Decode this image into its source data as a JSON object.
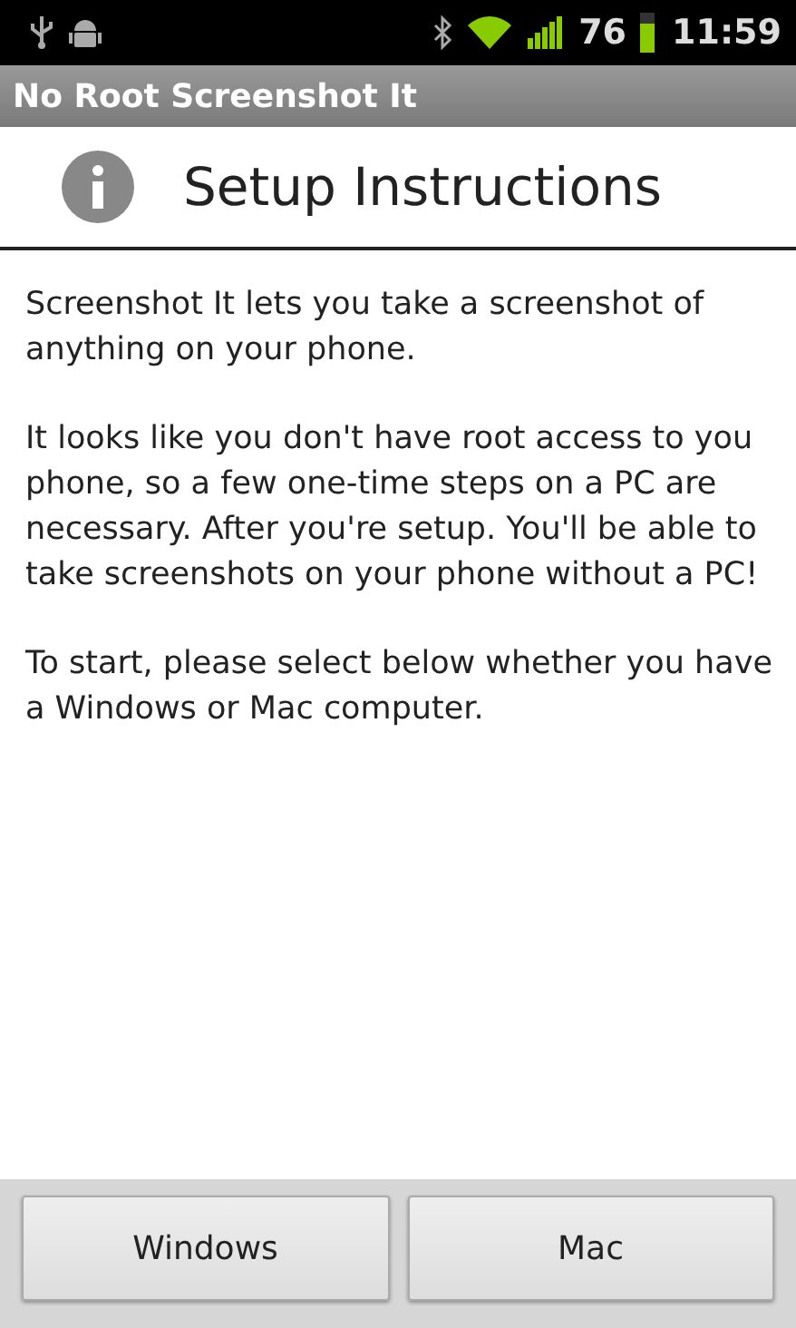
{
  "status_bar": {
    "battery": "76",
    "time": "11:59"
  },
  "app_bar": {
    "title": "No Root Screenshot It"
  },
  "header": {
    "title": "Setup Instructions"
  },
  "paragraphs": [
    "Screenshot It lets you take a screenshot of anything on your phone.",
    "It looks like you don't have root access to you phone, so a few one-time steps on a PC are necessary. After you're setup. You'll be able to take screenshots on your phone without a PC!",
    "To start, please select below whether you have a Windows or Mac computer."
  ],
  "buttons": [
    "Windows",
    "Mac"
  ]
}
